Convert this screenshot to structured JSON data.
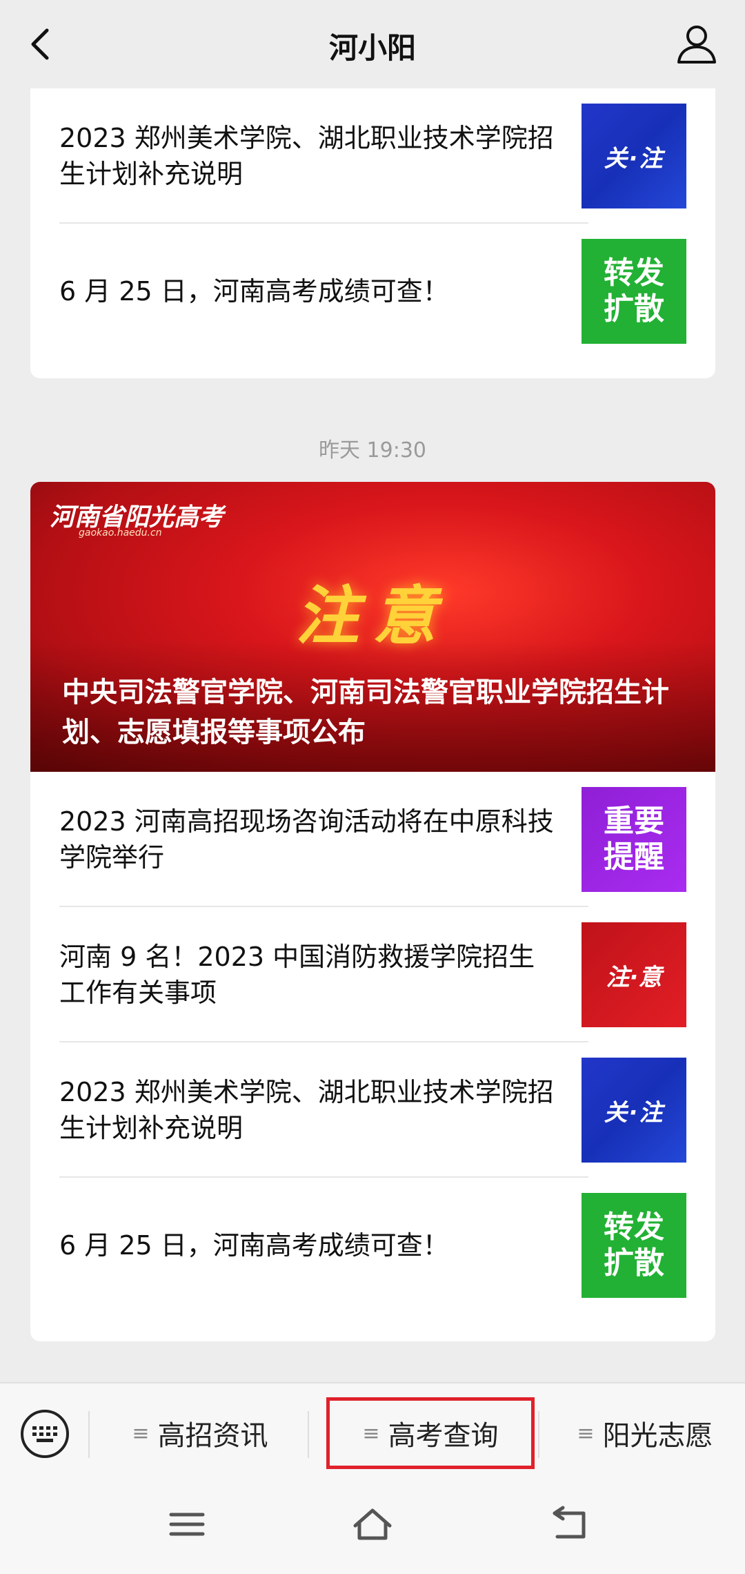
{
  "header": {
    "title": "河小阳"
  },
  "card1": {
    "items": [
      {
        "text": "2023 郑州美术学院、湖北职业技术学院招生计划补充说明",
        "thumb": "关·注"
      },
      {
        "text": "6 月 25 日，河南高考成绩可查！",
        "thumb": "转发扩散"
      }
    ]
  },
  "timestamp": "昨天 19:30",
  "card2": {
    "banner": {
      "logo": "河南省阳光高考",
      "logo_sub": "gaokao.haedu.cn",
      "notice": "注意",
      "headline": "中央司法警官学院、河南司法警官职业学院招生计划、志愿填报等事项公布"
    },
    "items": [
      {
        "text": "2023 河南高招现场咨询活动将在中原科技学院举行",
        "thumb": "重要提醒"
      },
      {
        "text": "河南 9 名！2023 中国消防救援学院招生工作有关事项",
        "thumb": "注·意"
      },
      {
        "text": "2023 郑州美术学院、湖北职业技术学院招生计划补充说明",
        "thumb": "关·注"
      },
      {
        "text": "6 月 25 日，河南高考成绩可查！",
        "thumb": "转发扩散"
      }
    ]
  },
  "menu": {
    "items": [
      "高招资讯",
      "高考查询",
      "阳光志愿"
    ],
    "highlight_color": "#e0212b"
  },
  "colors": {
    "background": "#ededed",
    "thumb_blue": "#1730b8",
    "thumb_green": "#22b134",
    "thumb_purple": "#a92cf0",
    "thumb_red": "#e21e25"
  }
}
